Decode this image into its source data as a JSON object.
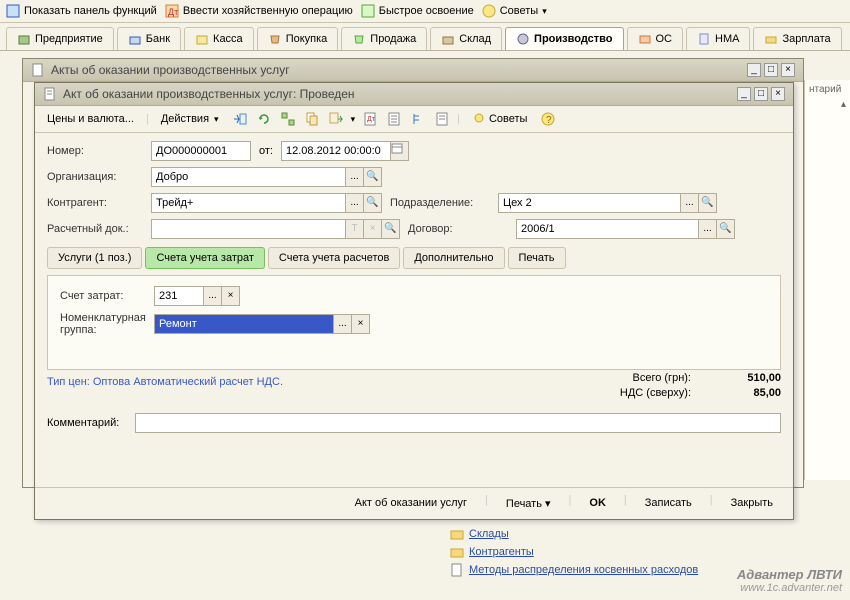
{
  "top_toolbar": {
    "show_panel": "Показать панель функций",
    "enter_op": "Ввести хозяйственную операцию",
    "quick": "Быстрое освоение",
    "tips": "Советы"
  },
  "main_tabs": [
    {
      "label": "Предприятие"
    },
    {
      "label": "Банк"
    },
    {
      "label": "Касса"
    },
    {
      "label": "Покупка"
    },
    {
      "label": "Продажа"
    },
    {
      "label": "Склад"
    },
    {
      "label": "Производство",
      "active": true
    },
    {
      "label": "ОС"
    },
    {
      "label": "НМА"
    },
    {
      "label": "Зарплата"
    }
  ],
  "list_window": {
    "title": "Акты об оказании производственных услуг"
  },
  "doc_window": {
    "title": "Акт об оказании производственных услуг: Проведен",
    "toolbar": {
      "prices": "Цены и валюта...",
      "actions": "Действия",
      "tips": "Советы"
    },
    "fields": {
      "number_label": "Номер:",
      "number": "ДО000000001",
      "from_label": "от:",
      "date": "12.08.2012 00:00:0",
      "org_label": "Организация:",
      "org": "Добро",
      "contragent_label": "Контрагент:",
      "contragent": "Трейд+",
      "division_label": "Подразделение:",
      "division": "Цех 2",
      "settlement_label": "Расчетный док.:",
      "settlement": "",
      "contract_label": "Договор:",
      "contract": "2006/1"
    },
    "sub_tabs": [
      {
        "label": "Услуги (1 поз.)"
      },
      {
        "label": "Счета учета затрат",
        "active": true
      },
      {
        "label": "Счета учета расчетов"
      },
      {
        "label": "Дополнительно"
      },
      {
        "label": "Печать"
      }
    ],
    "cost_tab": {
      "account_label": "Счет затрат:",
      "account": "231",
      "nomgroup_label": "Номенклатурная группа:",
      "nomgroup": "Ремонт"
    },
    "price_line": "Тип цен: Оптова Автоматический расчет НДС.",
    "totals": {
      "total_label": "Всего (грн):",
      "total": "510,00",
      "vat_label": "НДС (сверху):",
      "vat": "85,00"
    },
    "comment_label": "Комментарий:",
    "comment": "",
    "bottom": {
      "act": "Акт об оказании услуг",
      "print": "Печать",
      "ok": "OK",
      "save": "Записать",
      "close": "Закрыть"
    }
  },
  "side_links": [
    {
      "label": "Склады"
    },
    {
      "label": "Контрагенты"
    },
    {
      "label": "Методы распределения косвенных расходов"
    }
  ],
  "right_panel": "нтарий",
  "watermark": {
    "line1": "Адвантер ЛВТИ",
    "line2": "www.1c.advanter.net"
  }
}
